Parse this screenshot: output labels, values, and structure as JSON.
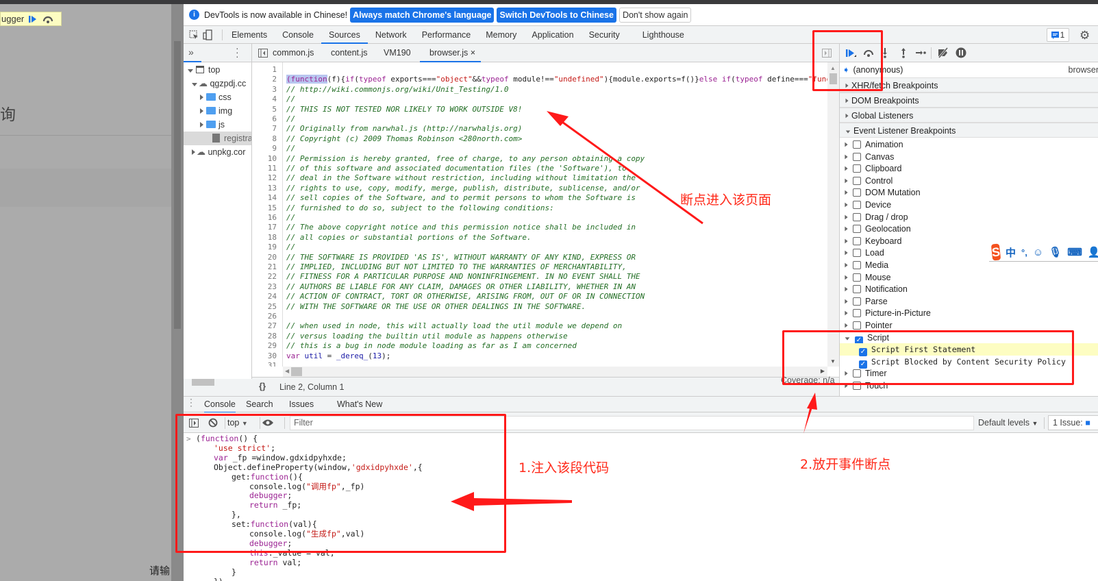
{
  "page": {
    "paused_label": "ugger",
    "heading_fragment": "询",
    "input_fragment": "请输"
  },
  "infobar": {
    "message": "DevTools is now available in Chinese!",
    "btn_match": "Always match Chrome's language",
    "btn_switch": "Switch DevTools to Chinese",
    "btn_dismiss": "Don't show again"
  },
  "tabs": [
    "Elements",
    "Console",
    "Sources",
    "Network",
    "Performance",
    "Memory",
    "Application",
    "Security",
    "Lighthouse"
  ],
  "active_tab": "Sources",
  "issues_count": "1",
  "file_tabs": [
    "common.js",
    "content.js",
    "VM190",
    "browser.js"
  ],
  "file_close": "×",
  "navigator": {
    "top": "top",
    "domain1": "qgzpdj.cc",
    "css": "css",
    "img": "img",
    "js": "js",
    "file": "registra",
    "domain2": "unpkg.cor"
  },
  "code": [
    [],
    [
      [
        "hl kw",
        "(function"
      ],
      [
        "",
        "(f){"
      ],
      [
        "kw",
        "if"
      ],
      [
        "",
        "("
      ],
      [
        "kw",
        "typeof"
      ],
      [
        "",
        " exports==="
      ],
      [
        "str",
        "\"object\""
      ],
      [
        "",
        "&&"
      ],
      [
        "kw",
        "typeof"
      ],
      [
        "",
        " module!=="
      ],
      [
        "str",
        "\"undefined\""
      ],
      [
        "",
        "){module.exports=f()}"
      ],
      [
        "kw",
        "else if"
      ],
      [
        "",
        "("
      ],
      [
        "kw",
        "typeof"
      ],
      [
        "",
        " define==="
      ],
      [
        "str",
        "\"func"
      ]
    ],
    [
      [
        "cm",
        "// http://wiki.commonjs.org/wiki/Unit_Testing/1.0"
      ]
    ],
    [
      [
        "cm",
        "//"
      ]
    ],
    [
      [
        "cm",
        "// THIS IS NOT TESTED NOR LIKELY TO WORK OUTSIDE V8!"
      ]
    ],
    [
      [
        "cm",
        "//"
      ]
    ],
    [
      [
        "cm",
        "// Originally from narwhal.js (http://narwhaljs.org)"
      ]
    ],
    [
      [
        "cm",
        "// Copyright (c) 2009 Thomas Robinson <280north.com>"
      ]
    ],
    [
      [
        "cm",
        "//"
      ]
    ],
    [
      [
        "cm",
        "// Permission is hereby granted, free of charge, to any person obtaining a copy"
      ]
    ],
    [
      [
        "cm",
        "// of this software and associated documentation files (the 'Software'), to"
      ]
    ],
    [
      [
        "cm",
        "// deal in the Software without restriction, including without limitation the"
      ]
    ],
    [
      [
        "cm",
        "// rights to use, copy, modify, merge, publish, distribute, sublicense, and/or"
      ]
    ],
    [
      [
        "cm",
        "// sell copies of the Software, and to permit persons to whom the Software is"
      ]
    ],
    [
      [
        "cm",
        "// furnished to do so, subject to the following conditions:"
      ]
    ],
    [
      [
        "cm",
        "//"
      ]
    ],
    [
      [
        "cm",
        "// The above copyright notice and this permission notice shall be included in"
      ]
    ],
    [
      [
        "cm",
        "// all copies or substantial portions of the Software."
      ]
    ],
    [
      [
        "cm",
        "//"
      ]
    ],
    [
      [
        "cm",
        "// THE SOFTWARE IS PROVIDED 'AS IS', WITHOUT WARRANTY OF ANY KIND, EXPRESS OR"
      ]
    ],
    [
      [
        "cm",
        "// IMPLIED, INCLUDING BUT NOT LIMITED TO THE WARRANTIES OF MERCHANTABILITY,"
      ]
    ],
    [
      [
        "cm",
        "// FITNESS FOR A PARTICULAR PURPOSE AND NONINFRINGEMENT. IN NO EVENT SHALL THE"
      ]
    ],
    [
      [
        "cm",
        "// AUTHORS BE LIABLE FOR ANY CLAIM, DAMAGES OR OTHER LIABILITY, WHETHER IN AN"
      ]
    ],
    [
      [
        "cm",
        "// ACTION OF CONTRACT, TORT OR OTHERWISE, ARISING FROM, OUT OF OR IN CONNECTION"
      ]
    ],
    [
      [
        "cm",
        "// WITH THE SOFTWARE OR THE USE OR OTHER DEALINGS IN THE SOFTWARE."
      ]
    ],
    [],
    [
      [
        "cm",
        "// when used in node, this will actually load the util module we depend on"
      ]
    ],
    [
      [
        "cm",
        "// versus loading the builtin util module as happens otherwise"
      ]
    ],
    [
      [
        "cm",
        "// this is a bug in node module loading as far as I am concerned"
      ]
    ],
    [
      [
        "kw",
        "var"
      ],
      [
        "fn",
        " util"
      ],
      [
        "",
        " = "
      ],
      [
        "fn",
        "_dereq_"
      ],
      [
        "",
        "("
      ],
      [
        "fn",
        "13"
      ],
      [
        "",
        ");"
      ]
    ],
    [],
    []
  ],
  "status": {
    "position": "Line 2, Column 1",
    "coverage": "Coverage: n/a"
  },
  "debugger": {
    "call_frame": "(anonymous)",
    "call_frame_file": "browser",
    "sections": [
      "XHR/fetch Breakpoints",
      "DOM Breakpoints",
      "Global Listeners",
      "Event Listener Breakpoints"
    ],
    "events": [
      {
        "label": "Animation",
        "checked": false
      },
      {
        "label": "Canvas",
        "checked": false
      },
      {
        "label": "Clipboard",
        "checked": false
      },
      {
        "label": "Control",
        "checked": false
      },
      {
        "label": "DOM Mutation",
        "checked": false
      },
      {
        "label": "Device",
        "checked": false
      },
      {
        "label": "Drag / drop",
        "checked": false
      },
      {
        "label": "Geolocation",
        "checked": false
      },
      {
        "label": "Keyboard",
        "checked": false
      },
      {
        "label": "Load",
        "checked": false
      },
      {
        "label": "Media",
        "checked": false
      },
      {
        "label": "Mouse",
        "checked": false
      },
      {
        "label": "Notification",
        "checked": false
      },
      {
        "label": "Parse",
        "checked": false
      },
      {
        "label": "Picture-in-Picture",
        "checked": false
      },
      {
        "label": "Pointer",
        "checked": false
      },
      {
        "label": "Script",
        "checked": true,
        "expanded": true
      },
      {
        "label": "Script First Statement",
        "checked": true,
        "child": true,
        "highlight": true
      },
      {
        "label": "Script Blocked by Content Security Policy",
        "checked": true,
        "child": true
      },
      {
        "label": "Timer",
        "checked": false
      },
      {
        "label": "Touch",
        "checked": false
      }
    ]
  },
  "drawer_tabs": [
    "Console",
    "Search",
    "Issues",
    "What's New"
  ],
  "console": {
    "context": "top",
    "filter_placeholder": "Filter",
    "levels": "Default levels",
    "issues": "1 Issue:",
    "prompt": ">",
    "lines": [
      [
        0,
        [
          [
            "",
            "("
          ],
          [
            "kw",
            "function"
          ],
          [
            "",
            "() {"
          ]
        ]
      ],
      [
        1,
        [
          [
            "str",
            "'use strict'"
          ],
          [
            "",
            ";"
          ]
        ]
      ],
      [
        1,
        [
          [
            "kw",
            "var"
          ],
          [
            "",
            " _fp =window.gdxidpyhxde;"
          ]
        ]
      ],
      [
        1,
        [
          [
            "",
            "Object.defineProperty(window,"
          ],
          [
            "str",
            "'gdxidpyhxde'"
          ],
          [
            "",
            ",{"
          ]
        ]
      ],
      [
        2,
        [
          [
            "",
            "get:"
          ],
          [
            "kw",
            "function"
          ],
          [
            "",
            "(){"
          ]
        ]
      ],
      [
        3,
        [
          [
            "",
            "console.log("
          ],
          [
            "str",
            "\"调用fp\""
          ],
          [
            "",
            ",_fp)"
          ]
        ]
      ],
      [
        3,
        [
          [
            "kw",
            "debugger"
          ],
          [
            "",
            ";"
          ]
        ]
      ],
      [
        3,
        [
          [
            "kw",
            "return"
          ],
          [
            "",
            " _fp;"
          ]
        ]
      ],
      [
        2,
        [
          [
            "",
            "},"
          ]
        ]
      ],
      [
        2,
        [
          [
            "",
            "set:"
          ],
          [
            "kw",
            "function"
          ],
          [
            "",
            "(val){"
          ]
        ]
      ],
      [
        3,
        [
          [
            "",
            "console.log("
          ],
          [
            "str",
            "\"生成fp\""
          ],
          [
            "",
            ",val)"
          ]
        ]
      ],
      [
        3,
        [
          [
            "kw",
            "debugger"
          ],
          [
            "",
            ";"
          ]
        ]
      ],
      [
        3,
        [
          [
            "kw",
            "this"
          ],
          [
            "",
            "._value = val;"
          ]
        ]
      ],
      [
        3,
        [
          [
            "kw",
            "return"
          ],
          [
            "",
            " val;"
          ]
        ]
      ],
      [
        2,
        [
          [
            "",
            "}"
          ]
        ]
      ],
      [
        1,
        [
          [
            "",
            "})"
          ]
        ]
      ]
    ]
  },
  "annotations": {
    "a1": "断点进入该页面",
    "a2": "2.放开事件断点",
    "a3": "1.注入该段代码",
    "color": "#ff1a1a"
  },
  "ime": {
    "brand": "S",
    "mode": "中",
    "punct": "°,"
  }
}
